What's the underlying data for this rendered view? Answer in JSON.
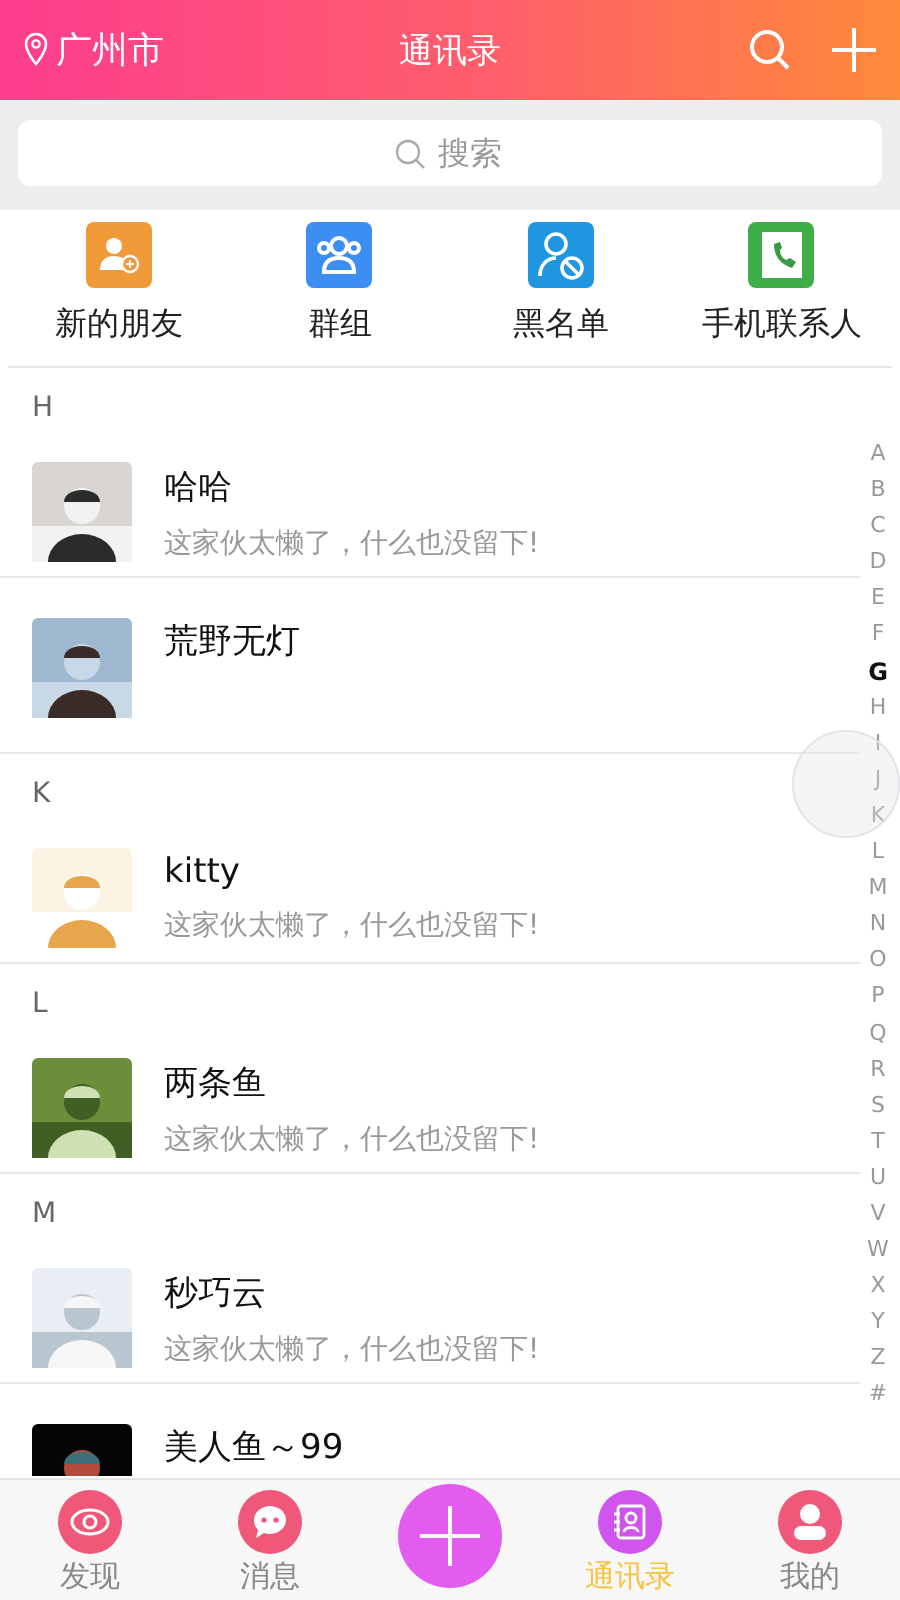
{
  "header": {
    "location": "广州市",
    "title": "通讯录"
  },
  "search": {
    "placeholder": "搜索"
  },
  "shortcuts": [
    {
      "label": "新的朋友",
      "kind": "new-friend",
      "color": "#f19a3a"
    },
    {
      "label": "群组",
      "kind": "group",
      "color": "#3d8ef2"
    },
    {
      "label": "黑名单",
      "kind": "blocked",
      "color": "#2196e0"
    },
    {
      "label": "手机联系人",
      "kind": "phone",
      "color": "#3fae49"
    }
  ],
  "sections": [
    {
      "letter": "H",
      "contacts": [
        {
          "name": "哈哈",
          "status": "这家伙太懒了，什么也没留下!"
        },
        {
          "name": "荒野无灯"
        }
      ]
    },
    {
      "letter": "K",
      "contacts": [
        {
          "name": "kitty",
          "status": "这家伙太懒了，什么也没留下!"
        }
      ]
    },
    {
      "letter": "L",
      "contacts": [
        {
          "name": "两条鱼",
          "status": "这家伙太懒了，什么也没留下!"
        }
      ]
    },
    {
      "letter": "M",
      "contacts": [
        {
          "name": "秒巧云",
          "status": "这家伙太懒了，什么也没留下!"
        },
        {
          "name": "美人鱼～99"
        }
      ]
    }
  ],
  "index": [
    {
      "letter": "A",
      "selected": false
    },
    {
      "letter": "B",
      "selected": false
    },
    {
      "letter": "C",
      "selected": false
    },
    {
      "letter": "D",
      "selected": false
    },
    {
      "letter": "E",
      "selected": false
    },
    {
      "letter": "F",
      "selected": false
    },
    {
      "letter": "G",
      "selected": true
    },
    {
      "letter": "H",
      "selected": false
    },
    {
      "letter": "I",
      "selected": false
    },
    {
      "letter": "J",
      "selected": false
    },
    {
      "letter": "K",
      "selected": false
    },
    {
      "letter": "L",
      "selected": false
    },
    {
      "letter": "M",
      "selected": false
    },
    {
      "letter": "N",
      "selected": false
    },
    {
      "letter": "O",
      "selected": false
    },
    {
      "letter": "P",
      "selected": false
    },
    {
      "letter": "Q",
      "selected": false
    },
    {
      "letter": "R",
      "selected": false
    },
    {
      "letter": "S",
      "selected": false
    },
    {
      "letter": "T",
      "selected": false
    },
    {
      "letter": "U",
      "selected": false
    },
    {
      "letter": "V",
      "selected": false
    },
    {
      "letter": "W",
      "selected": false
    },
    {
      "letter": "X",
      "selected": false
    },
    {
      "letter": "Y",
      "selected": false
    },
    {
      "letter": "Z",
      "selected": false
    },
    {
      "letter": "#",
      "selected": false
    }
  ],
  "tabs": [
    {
      "label": "发现",
      "kind": "discover",
      "selected": false
    },
    {
      "label": "消息",
      "kind": "messages",
      "selected": false
    },
    {
      "kind": "add",
      "selected": false
    },
    {
      "label": "通讯录",
      "kind": "contacts",
      "selected": true
    },
    {
      "label": "我的",
      "kind": "profile",
      "selected": false
    }
  ]
}
